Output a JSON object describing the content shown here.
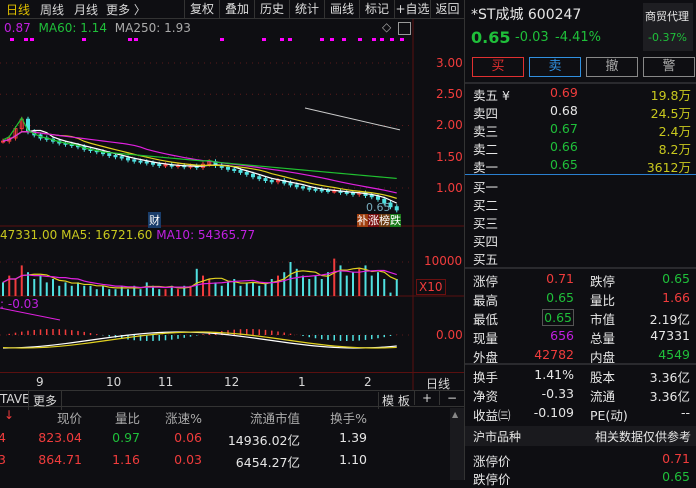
{
  "toolbar": {
    "periods": [
      "日线",
      "周线",
      "月线",
      "更多 〉"
    ],
    "buttons": [
      "复权",
      "叠加",
      "历史",
      "统计",
      "画线",
      "标记",
      "+自选",
      "返回"
    ]
  },
  "ma_legend": {
    "ma_prefix": "0.87",
    "ma60": "MA60: 1.14",
    "ma250": "MA250: 1.93"
  },
  "price_axis": [
    "3.00",
    "2.50",
    "2.00",
    "1.50",
    "1.00"
  ],
  "price_labels": {
    "last": "0.65",
    "fin": "财",
    "tags": [
      "补",
      "涨",
      "榜",
      "跌"
    ]
  },
  "vol_legend": {
    "vol": "47331.00",
    "ma5": "MA5: 16721.60",
    "ma10": "MA10: 54365.77"
  },
  "vol_axis": {
    "level": "10000",
    "unit": "X10"
  },
  "macd_legend": {
    "val": ": -0.03",
    "zero": "0.00"
  },
  "x_axis": {
    "months": [
      "9",
      "10",
      "11",
      "12",
      "1",
      "2"
    ],
    "period": "日线"
  },
  "tabs": {
    "left": "TAVE",
    "more": "更多",
    "template": "模 板",
    "plus": "+",
    "minus": "−"
  },
  "table": {
    "sort_icon": "↓",
    "headers": [
      "现价",
      "量比",
      "涨速%",
      "流通市值",
      "换手%"
    ],
    "rows": [
      {
        "lead": "4",
        "price": "823.04",
        "ratio": "0.97",
        "speed": "0.06",
        "cap": "14936.02亿",
        "turn": "1.39"
      },
      {
        "lead": "3",
        "price": "864.71",
        "ratio": "1.16",
        "speed": "0.03",
        "cap": "6454.27亿",
        "turn": "1.10"
      }
    ]
  },
  "quote": {
    "title": "*ST成城 600247",
    "price": "0.65",
    "change": "-0.03",
    "pct": "-4.41%",
    "sector": "商贸代理",
    "sector_pct": "-0.37%"
  },
  "actions": [
    "买",
    "卖",
    "撤",
    "警"
  ],
  "asks": [
    {
      "label": "卖五 ¥",
      "price": "0.69",
      "vol": "19.8万"
    },
    {
      "label": "卖四",
      "price": "0.68",
      "vol": "24.5万"
    },
    {
      "label": "卖三",
      "price": "0.67",
      "vol": "2.4万"
    },
    {
      "label": "卖二",
      "price": "0.66",
      "vol": "8.2万"
    },
    {
      "label": "卖一",
      "price": "0.65",
      "vol": "3612万"
    }
  ],
  "bids": [
    "买一",
    "买二",
    "买三",
    "买四",
    "买五"
  ],
  "stats": [
    [
      "涨停",
      "0.71",
      "跌停",
      "0.65"
    ],
    [
      "最高",
      "0.65",
      "量比",
      "1.66"
    ],
    [
      "最低",
      "0.65",
      "市值",
      "2.19亿"
    ],
    [
      "现量",
      "656",
      "总量",
      "47331"
    ],
    [
      "外盘",
      "42782",
      "内盘",
      "4549"
    ]
  ],
  "stats2": [
    [
      "换手",
      "1.41%",
      "股本",
      "3.36亿"
    ],
    [
      "净资",
      "-0.33",
      "流通",
      "3.36亿"
    ],
    [
      "收益㈢",
      "-0.109",
      "PE(动)",
      "--"
    ]
  ],
  "market": {
    "name": "沪市品种",
    "note": "相关数据仅供参考"
  },
  "limits": [
    {
      "label": "涨停价",
      "value": "0.71"
    },
    {
      "label": "跌停价",
      "value": "0.65"
    }
  ],
  "chart_data": {
    "type": "candlestick",
    "closes": [
      1.75,
      1.8,
      1.95,
      2.1,
      1.9,
      1.85,
      1.8,
      1.78,
      1.75,
      1.72,
      1.7,
      1.68,
      1.66,
      1.62,
      1.6,
      1.58,
      1.55,
      1.52,
      1.5,
      1.48,
      1.45,
      1.43,
      1.42,
      1.4,
      1.38,
      1.36,
      1.37,
      1.35,
      1.36,
      1.34,
      1.35,
      1.33,
      1.38,
      1.42,
      1.36,
      1.33,
      1.3,
      1.28,
      1.25,
      1.22,
      1.18,
      1.15,
      1.12,
      1.1,
      1.12,
      1.08,
      1.05,
      1.02,
      1.0,
      0.98,
      0.97,
      0.96,
      0.95,
      0.95,
      0.93,
      0.92,
      0.9,
      0.92,
      0.88,
      0.86,
      0.82,
      0.76,
      0.7,
      0.65
    ],
    "ma250": [
      2.28,
      1.93
    ],
    "volumes": [
      4,
      6,
      5,
      9,
      7,
      5,
      6,
      4,
      5,
      3,
      4,
      3,
      4,
      3,
      3,
      2,
      3,
      2,
      2,
      3,
      2,
      3,
      2,
      4,
      3,
      2,
      2,
      3,
      2,
      3,
      3,
      8,
      6,
      5,
      4,
      3,
      4,
      5,
      3,
      4,
      4,
      3,
      4,
      5,
      6,
      7,
      10,
      8,
      6,
      5,
      6,
      5,
      7,
      11,
      9,
      6,
      7,
      8,
      9,
      6,
      7,
      5,
      1,
      5
    ],
    "vol_max": 10000,
    "price_range": [
      0.6,
      3.1
    ]
  }
}
